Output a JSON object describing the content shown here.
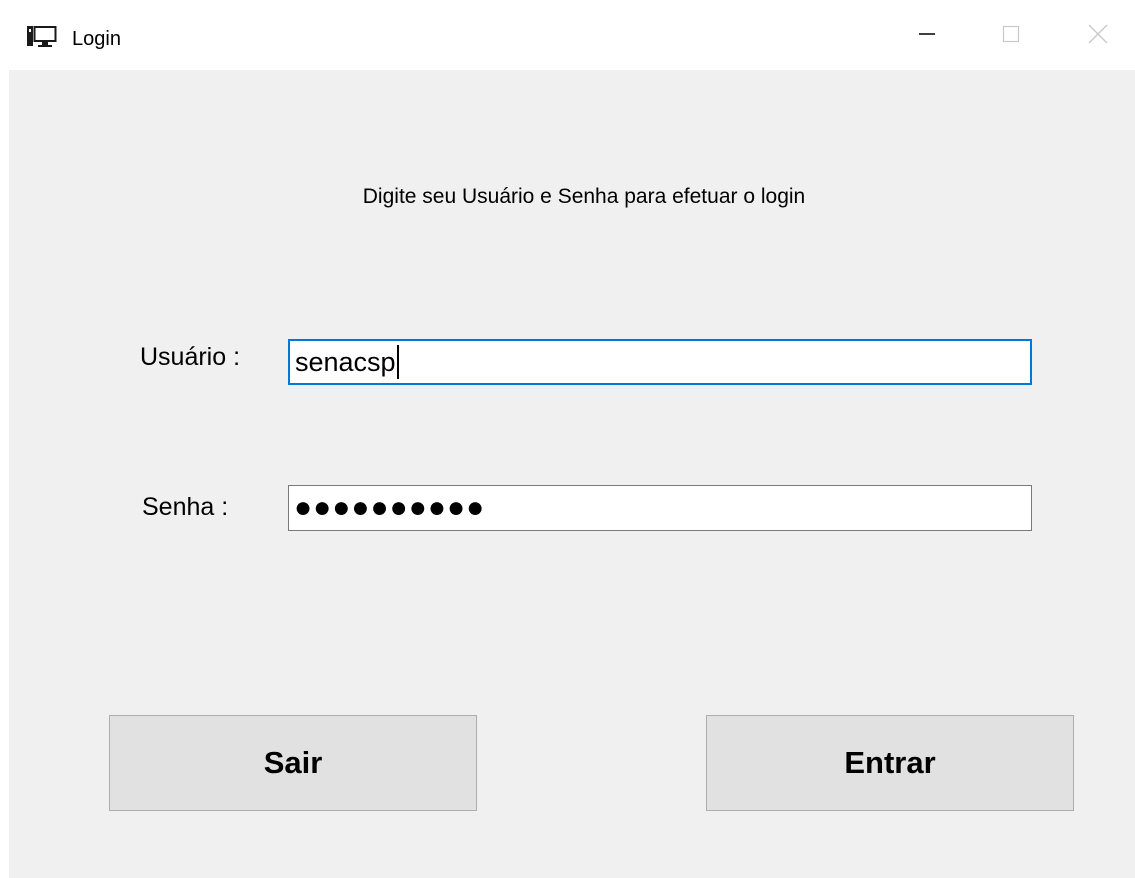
{
  "window": {
    "title": "Login",
    "icon": "monitor-icon",
    "controls": {
      "minimize": "minimize-icon",
      "maximize": "maximize-icon",
      "close": "close-icon"
    }
  },
  "form": {
    "instruction": "Digite seu Usuário e Senha para efetuar o login",
    "username_label": "Usuário :",
    "username_value": "senacsp",
    "password_label": "Senha :",
    "password_value": "●●●●●●●●●●"
  },
  "buttons": {
    "exit_label": "Sair",
    "enter_label": "Entrar"
  },
  "colors": {
    "client_background": "#f0f0f0",
    "focus_border": "#0078d7",
    "button_background": "#e1e1e1"
  }
}
